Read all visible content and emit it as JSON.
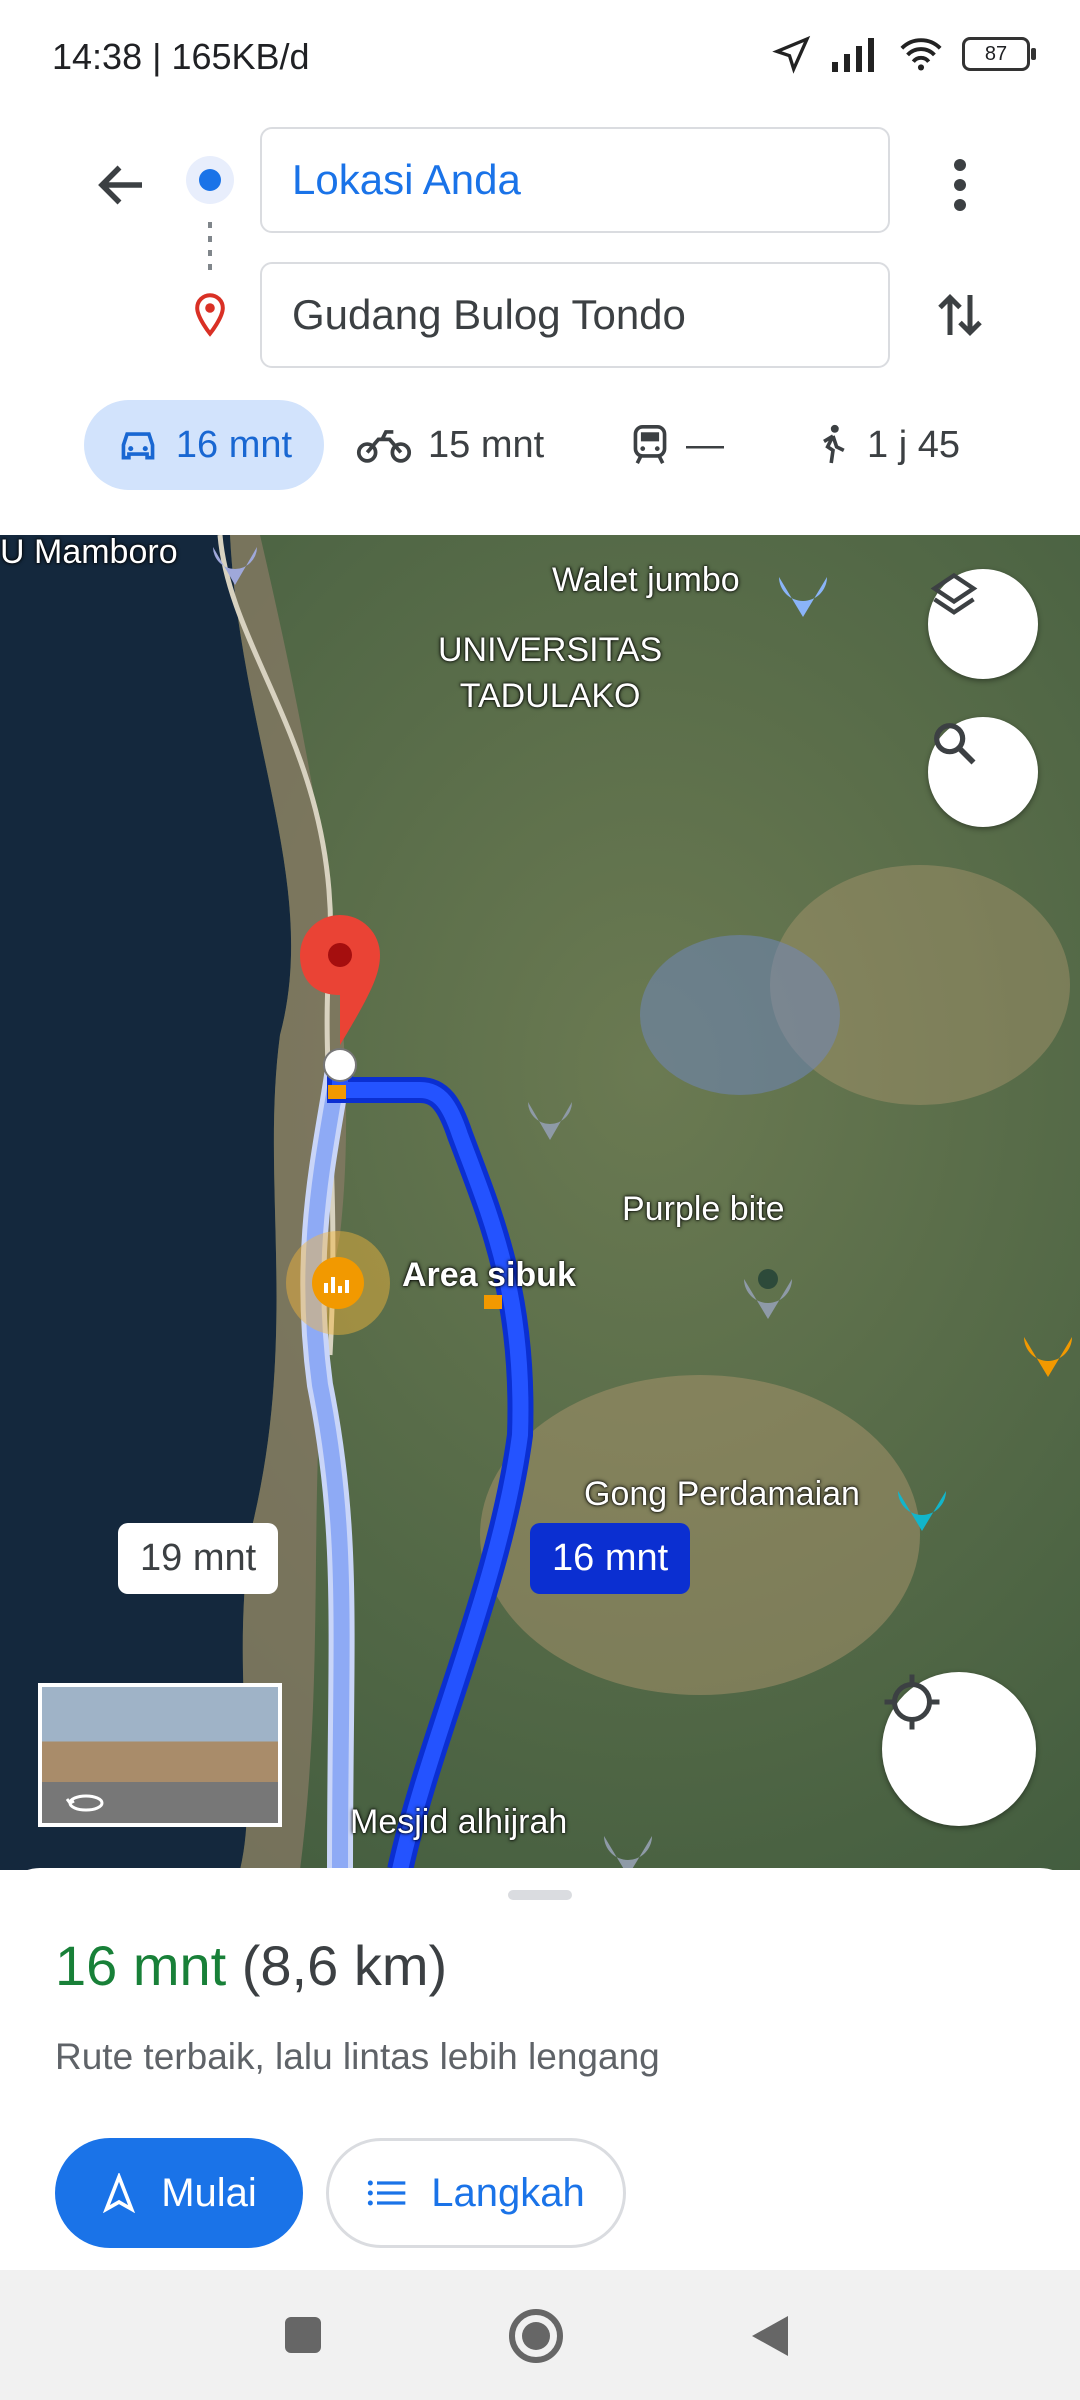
{
  "status_bar": {
    "time": "14:38 | 165KB/d",
    "battery": "87"
  },
  "search": {
    "origin": "Lokasi Anda",
    "destination": "Gudang Bulog Tondo"
  },
  "modes": [
    {
      "icon": "car-icon",
      "label": "16 mnt",
      "active": true
    },
    {
      "icon": "motorcycle-icon",
      "label": "15 mnt"
    },
    {
      "icon": "transit-icon",
      "label": "—"
    },
    {
      "icon": "walk-icon",
      "label": "1 j 45"
    }
  ],
  "map": {
    "labels": {
      "mamboro": "U Mamboro",
      "walet": "Walet jumbo",
      "universitas": "UNIVERSITAS\nTADULAKO",
      "purple": "Purple bite",
      "area": "Area sibuk",
      "gong": "Gong Perdamaian",
      "mesjid": "Mesjid alhijrah"
    },
    "route_alt_time": "19 mnt",
    "route_main_time": "16 mnt"
  },
  "sheet": {
    "duration": "16 mnt",
    "distance": "(8,6 km)",
    "description": "Rute terbaik, lalu lintas lebih lengang",
    "start_label": "Mulai",
    "steps_label": "Langkah"
  },
  "colors": {
    "accent": "#1a73e8",
    "route_main": "#1a3cf0",
    "duration_green": "#188038"
  }
}
